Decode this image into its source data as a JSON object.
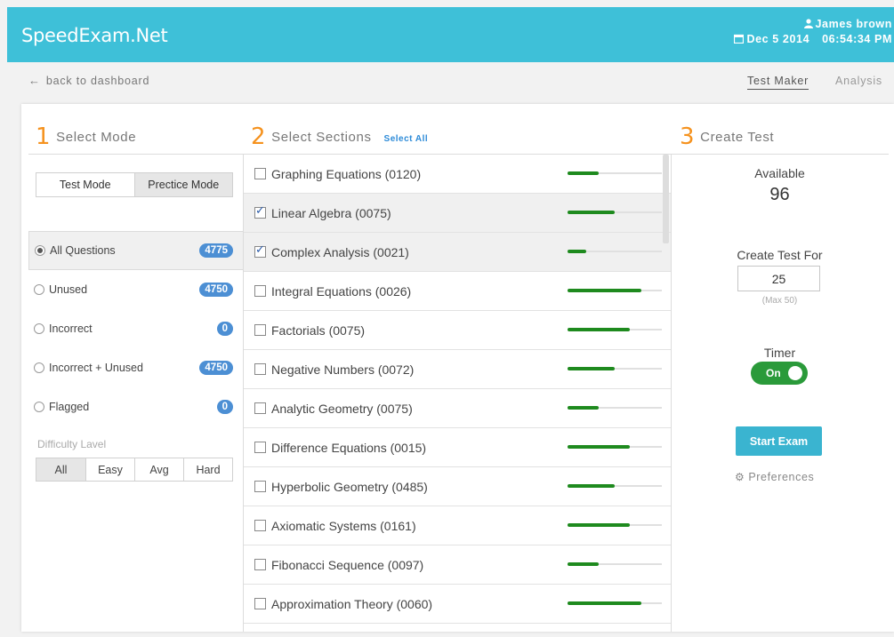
{
  "header": {
    "brand": "SpeedExam.Net",
    "user_name": "James brown",
    "date": "Dec 5 2014",
    "time": "06:54:34 PM",
    "bg_color": "#3ec0d8"
  },
  "topbar": {
    "back_label": "back to dashboard",
    "nav": [
      {
        "label": "Test Maker",
        "active": true
      },
      {
        "label": "Analysis",
        "active": false
      }
    ]
  },
  "mode": {
    "number": "1",
    "title": "Select Mode",
    "buttons": [
      {
        "label": "Test Mode",
        "active": false
      },
      {
        "label": "Prectice Mode",
        "active": true
      }
    ],
    "questions": [
      {
        "label": "All Questions",
        "count": "4775",
        "selected": true
      },
      {
        "label": "Unused",
        "count": "4750",
        "selected": false
      },
      {
        "label": "Incorrect",
        "count": "0",
        "selected": false
      },
      {
        "label": "Incorrect + Unused",
        "count": "4750",
        "selected": false
      },
      {
        "label": "Flagged",
        "count": "0",
        "selected": false
      }
    ],
    "difficulty_label": "Difficulty Lavel",
    "difficulty": [
      {
        "label": "All",
        "active": true
      },
      {
        "label": "Easy",
        "active": false
      },
      {
        "label": "Avg",
        "active": false
      },
      {
        "label": "Hard",
        "active": false
      }
    ]
  },
  "sections": {
    "number": "2",
    "title": "Select Sections",
    "select_all": "Select All",
    "items": [
      {
        "label": "Graphing Equations (0120)",
        "checked": false,
        "progress": 0.33
      },
      {
        "label": "Linear Algebra (0075)",
        "checked": true,
        "progress": 0.5
      },
      {
        "label": "Complex Analysis (0021)",
        "checked": true,
        "progress": 0.2
      },
      {
        "label": "Integral Equations (0026)",
        "checked": false,
        "progress": 0.78
      },
      {
        "label": "Factorials (0075)",
        "checked": false,
        "progress": 0.66
      },
      {
        "label": "Negative Numbers (0072)",
        "checked": false,
        "progress": 0.5
      },
      {
        "label": "Analytic Geometry (0075)",
        "checked": false,
        "progress": 0.33
      },
      {
        "label": "Difference Equations (0015)",
        "checked": false,
        "progress": 0.66
      },
      {
        "label": "Hyperbolic Geometry (0485)",
        "checked": false,
        "progress": 0.5
      },
      {
        "label": "Axiomatic Systems (0161)",
        "checked": false,
        "progress": 0.66
      },
      {
        "label": "Fibonacci Sequence (0097)",
        "checked": false,
        "progress": 0.33
      },
      {
        "label": "Approximation Theory (0060)",
        "checked": false,
        "progress": 0.78
      }
    ],
    "bar_color": "#1e8a1e"
  },
  "create": {
    "number": "3",
    "title": "Create Test",
    "available_label": "Available",
    "available_value": "96",
    "create_for_label": "Create Test For",
    "create_for_value": "25",
    "max_note": "(Max 50)",
    "timer_label": "Timer",
    "timer_state": "On",
    "start_label": "Start Exam",
    "preferences_label": "Preferences",
    "accent_color": "#f5921e"
  }
}
